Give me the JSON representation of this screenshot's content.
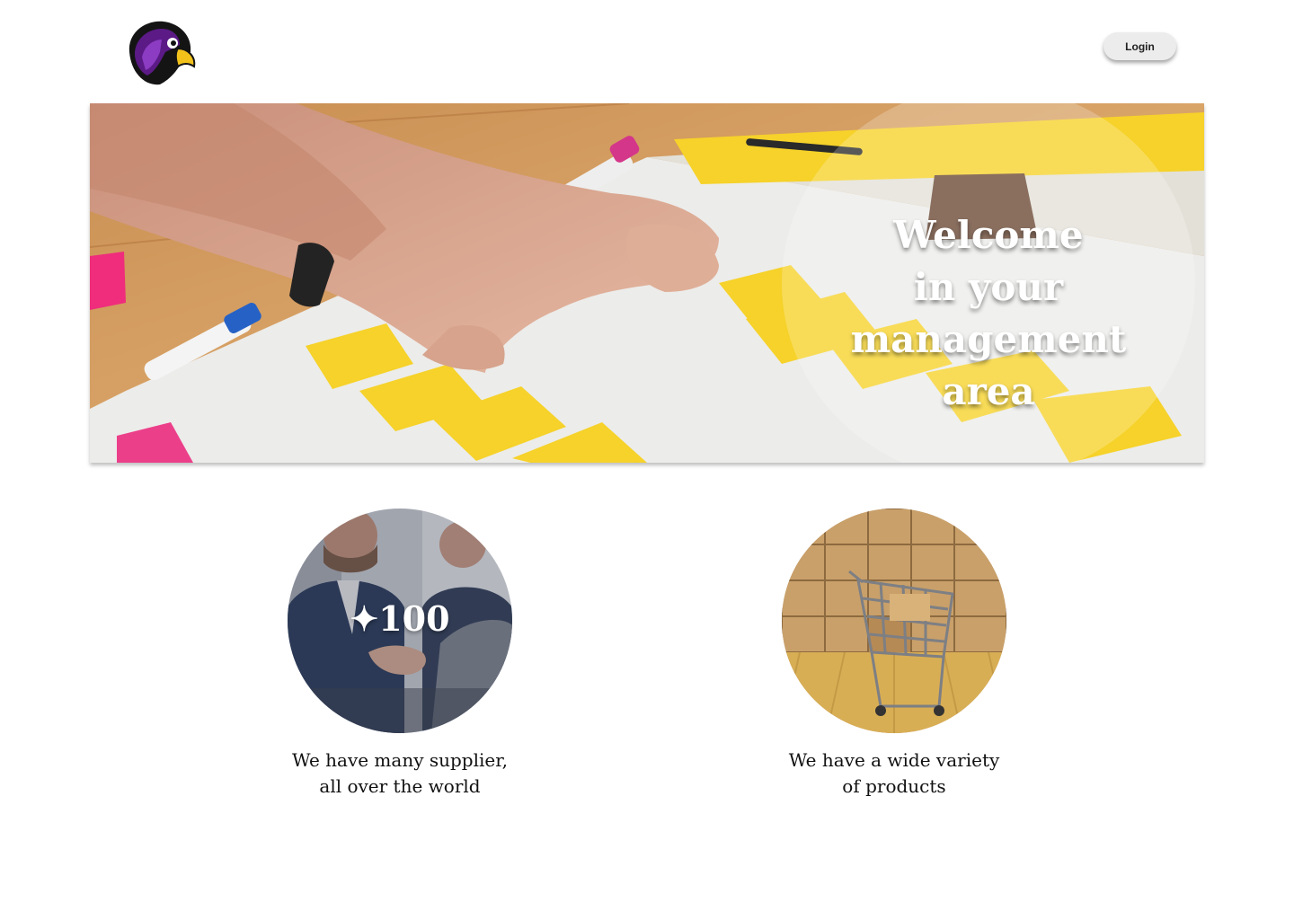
{
  "header": {
    "logo_icon": "falcon-logo-icon",
    "login_label": "Login"
  },
  "hero": {
    "title_line1": "Welcome",
    "title_line2": "in your management",
    "title_line3": "area",
    "image": "team-planning-sticky-notes-photo"
  },
  "features": [
    {
      "badge": "✦100",
      "caption_line1": "We have many supplier,",
      "caption_line2": "all over the world",
      "image": "business-handshake-photo"
    },
    {
      "caption_line1": "We have a wide variety",
      "caption_line2": "of products",
      "image": "shopping-cart-boxes-photo"
    }
  ],
  "colors": {
    "logo_purple": "#5b1a86",
    "logo_beak": "#f2c21b",
    "sticky_yellow": "#f6d22a",
    "button_bg": "#ececec"
  }
}
